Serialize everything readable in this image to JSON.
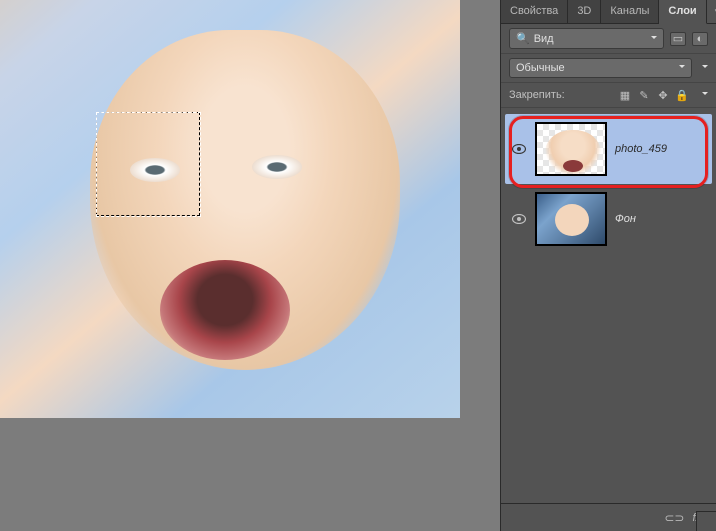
{
  "tabs": {
    "properties": "Свойства",
    "3d": "3D",
    "channels": "Каналы",
    "layers": "Слои"
  },
  "kind_dropdown": {
    "icon": "search-icon",
    "label": "Вид"
  },
  "blend_dropdown": {
    "label": "Обычные"
  },
  "lock_label": "Закрепить:",
  "layers_list": [
    {
      "visible": true,
      "name": "photo_459",
      "selected": true,
      "thumb": "baby-transparent"
    },
    {
      "visible": true,
      "name": "Фон",
      "selected": false,
      "thumb": "baby-blue"
    }
  ],
  "bottom_icons": {
    "link": "⊂⊃",
    "fx": "fx"
  }
}
